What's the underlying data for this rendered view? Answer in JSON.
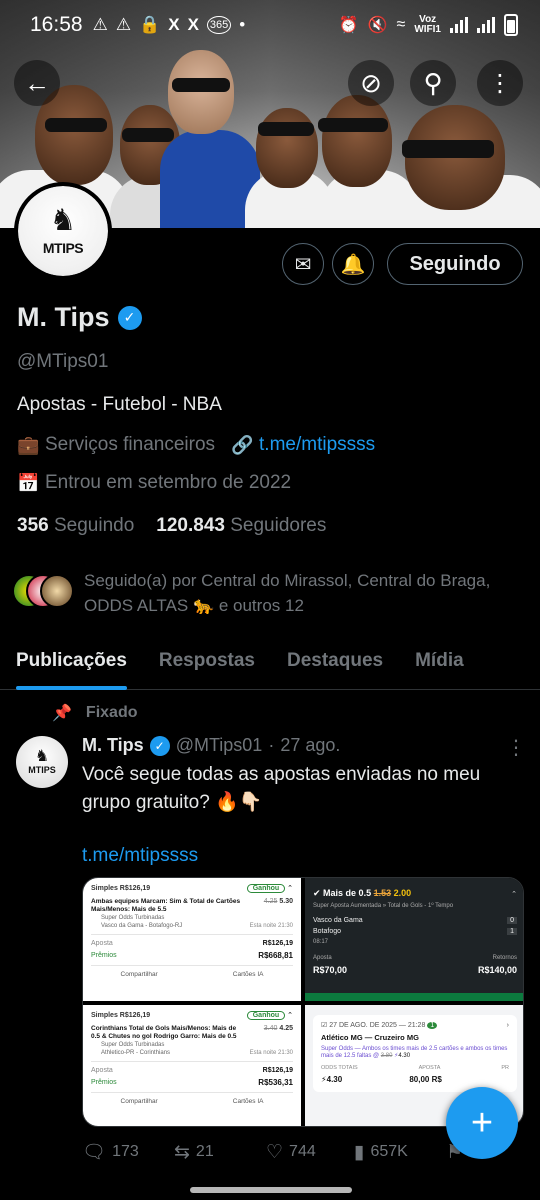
{
  "status_bar": {
    "time": "16:58",
    "left_icons": [
      "warning-icon",
      "warning-icon",
      "lock-icon",
      "x-icon",
      "x-icon",
      "365-icon",
      "dot-icon"
    ],
    "network_label_top": "Voz",
    "network_label_bottom": "WIFI1"
  },
  "header": {
    "back_icon": "back-arrow-icon",
    "grok_icon": "no-symbol-icon",
    "search_icon": "search-icon",
    "more_icon": "more-vertical-icon"
  },
  "profile": {
    "avatar_brand": "MTIPS",
    "name": "M. Tips",
    "handle": "@MTips01",
    "bio": "Apostas - Futebol - NBA",
    "category": "Serviços financeiros",
    "website": "t.me/mtipssss",
    "joined": "Entrou em setembro de 2022",
    "following_count": "356",
    "following_label": "Seguindo",
    "followers_count": "120.843",
    "followers_label": "Seguidores",
    "followed_by": "Seguido(a) por Central do Mirassol, Central do Braga, ODDS ALTAS 🐆 e outros 12",
    "follow_button": "Seguindo"
  },
  "tabs": [
    {
      "label": "Publicações",
      "active": true
    },
    {
      "label": "Respostas",
      "active": false
    },
    {
      "label": "Destaques",
      "active": false
    },
    {
      "label": "Mídia",
      "active": false
    }
  ],
  "post": {
    "pinned_label": "Fixado",
    "avatar_brand": "MTIPS",
    "name": "M. Tips",
    "handle": "@MTips01",
    "date": "27 ago.",
    "text": "Você segue todas as apostas enviadas no meu grupo gratuito? 🔥👇🏻",
    "link": "t.me/mtipssss",
    "replies": "173",
    "reposts": "21",
    "likes": "744",
    "views": "657K"
  },
  "media": {
    "t1": {
      "header": "Simples R$126,19",
      "badge": "Ganhou",
      "title": "Ambas equipes Marcam: Sim & Total de Cartões Mais/Menos: Mais de 5.5",
      "sub1": "Super Odds Turbinadas",
      "sub2": "Vasco da Gama - Botafogo-RJ",
      "time": "Esta noite 21:30",
      "old_odd": "4.25",
      "odd": "5.30",
      "aposta_label": "Aposta",
      "aposta": "R$126,19",
      "premios_label": "Prêmios",
      "premios": "R$668,81",
      "share": "Compartilhar",
      "cards": "Cartões IA"
    },
    "t2": {
      "market": "Mais de 0.5",
      "old_odd": "1.53",
      "odd": "2.00",
      "sub": "Super Aposta Aumentada",
      "sub2": "Total de Gols - 1º Tempo",
      "team1": "Vasco da Gama",
      "team2": "Botafogo",
      "score1": "0",
      "score2": "1",
      "clock": "08:17",
      "aposta_label": "Aposta",
      "aposta": "R$70,00",
      "retorno_label": "Retornos",
      "retorno": "R$140,00"
    },
    "t3": {
      "header": "Simples R$126,19",
      "badge": "Ganhou",
      "title": "Corinthians Total de Gols Mais/Menos: Mais de 0.5 & Chutes no gol Rodrigo Garro: Mais de 0.5",
      "sub1": "Super Odds Turbinadas",
      "sub2": "Athletico-PR - Corinthians",
      "time": "Esta noite 21:30",
      "old_odd": "3.40",
      "odd": "4.25",
      "aposta_label": "Aposta",
      "aposta": "R$126,19",
      "premios_label": "Prêmios",
      "premios": "R$536,31",
      "share": "Compartilhar",
      "cards": "Cartões IA"
    },
    "t4": {
      "date": "27 DE AGO. DE 2025 — 21:28",
      "count": "1",
      "match": "Atlético MG — Cruzeiro MG",
      "sub": "Super Odds — Ambos os times mais de 2.5 cartões e ambos os times mais de 12.5 faltas @",
      "old_odd": "3.80",
      "odd": "4.30",
      "odds_label": "ODDS TOTAIS",
      "odds_val": "4.30",
      "aposta_label": "APOSTA",
      "aposta_val": "80,00 R$",
      "premio_label": "PR"
    }
  },
  "colors": {
    "accent": "#1d9bf0",
    "muted": "#71767b",
    "text": "#e7e9ea",
    "background": "#000000"
  }
}
